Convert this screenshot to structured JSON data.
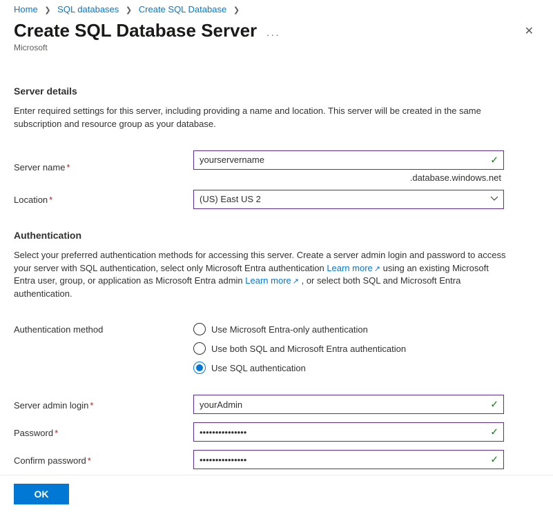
{
  "breadcrumb": {
    "items": [
      "Home",
      "SQL databases",
      "Create SQL Database"
    ]
  },
  "header": {
    "title": "Create SQL Database Server",
    "subtitle": "Microsoft"
  },
  "serverDetails": {
    "title": "Server details",
    "desc": "Enter required settings for this server, including providing a name and location. This server will be created in the same subscription and resource group as your database.",
    "serverNameLabel": "Server name",
    "serverNameValue": "yourservername",
    "serverNameSuffix": ".database.windows.net",
    "locationLabel": "Location",
    "locationValue": "(US) East US 2"
  },
  "auth": {
    "title": "Authentication",
    "descPart1": "Select your preferred authentication methods for accessing this server. Create a server admin login and password to access your server with SQL authentication, select only Microsoft Entra authentication ",
    "learnMore1": "Learn more",
    "descPart2": " using an existing Microsoft Entra user, group, or application as Microsoft Entra admin ",
    "learnMore2": "Learn more",
    "descPart3": " , or select both SQL and Microsoft Entra authentication.",
    "methodLabel": "Authentication method",
    "options": [
      "Use Microsoft Entra-only authentication",
      "Use both SQL and Microsoft Entra authentication",
      "Use SQL authentication"
    ],
    "adminLoginLabel": "Server admin login",
    "adminLoginValue": "yourAdmin",
    "passwordLabel": "Password",
    "passwordValue": "•••••••••••••••",
    "confirmLabel": "Confirm password",
    "confirmValue": "•••••••••••••••"
  },
  "footer": {
    "ok": "OK"
  }
}
